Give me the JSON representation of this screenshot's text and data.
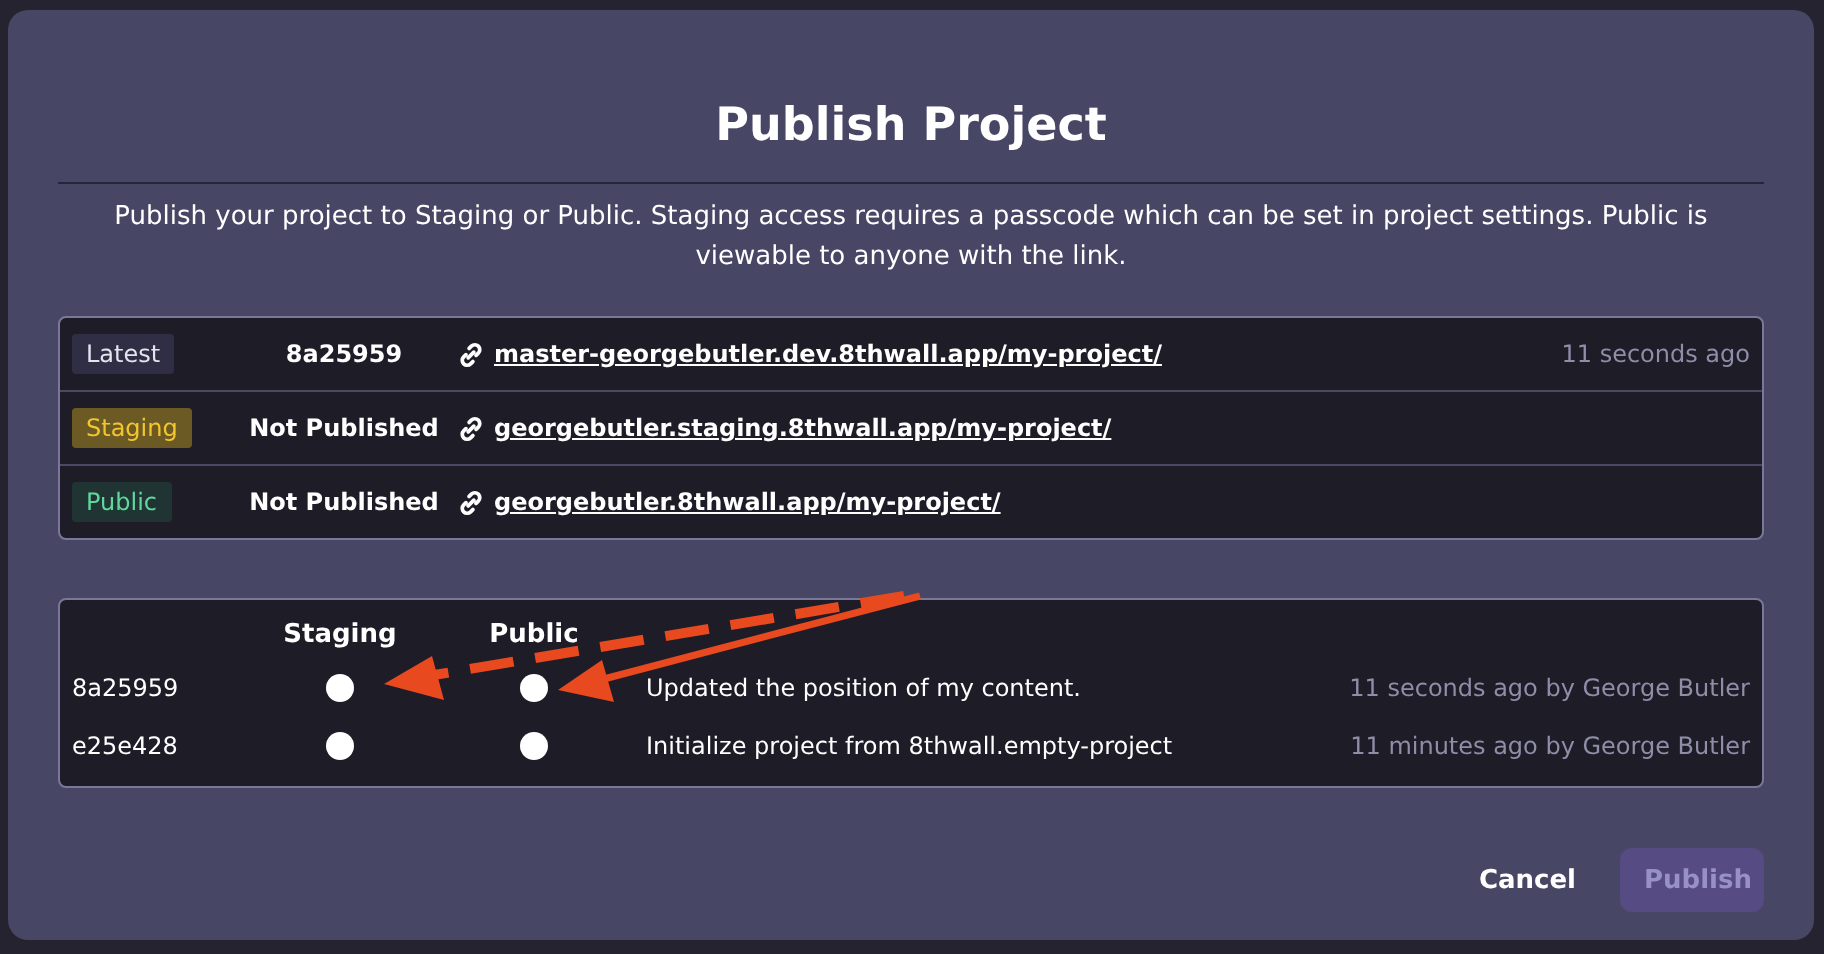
{
  "dialog": {
    "title": "Publish Project",
    "description": "Publish your project to Staging or Public. Staging access requires a passcode which can be set in project settings. Public is viewable to anyone with the link."
  },
  "environments": [
    {
      "tag": "Latest",
      "kind": "latest",
      "status": "8a25959",
      "url": "master-georgebutler.dev.8thwall.app/my-project/",
      "time": "11 seconds ago"
    },
    {
      "tag": "Staging",
      "kind": "staging",
      "status": "Not Published",
      "url": "georgebutler.staging.8thwall.app/my-project/"
    },
    {
      "tag": "Public",
      "kind": "public",
      "status": "Not Published",
      "url": "georgebutler.8thwall.app/my-project/"
    }
  ],
  "commits": {
    "columns": [
      "Staging",
      "Public"
    ],
    "rows": [
      {
        "hash": "8a25959",
        "staging_selected": false,
        "public_selected": false,
        "message": "Updated the position of my content.",
        "time": "11 seconds ago by George Butler"
      },
      {
        "hash": "e25e428",
        "staging_selected": false,
        "public_selected": false,
        "message": "Initialize project from 8thwall.empty-project",
        "time": "11 minutes ago by George Butler"
      }
    ]
  },
  "buttons": [
    {
      "label": "Cancel",
      "kind": "text",
      "disabled": false
    },
    {
      "label": "Publish",
      "kind": "primary",
      "disabled": true
    }
  ]
}
